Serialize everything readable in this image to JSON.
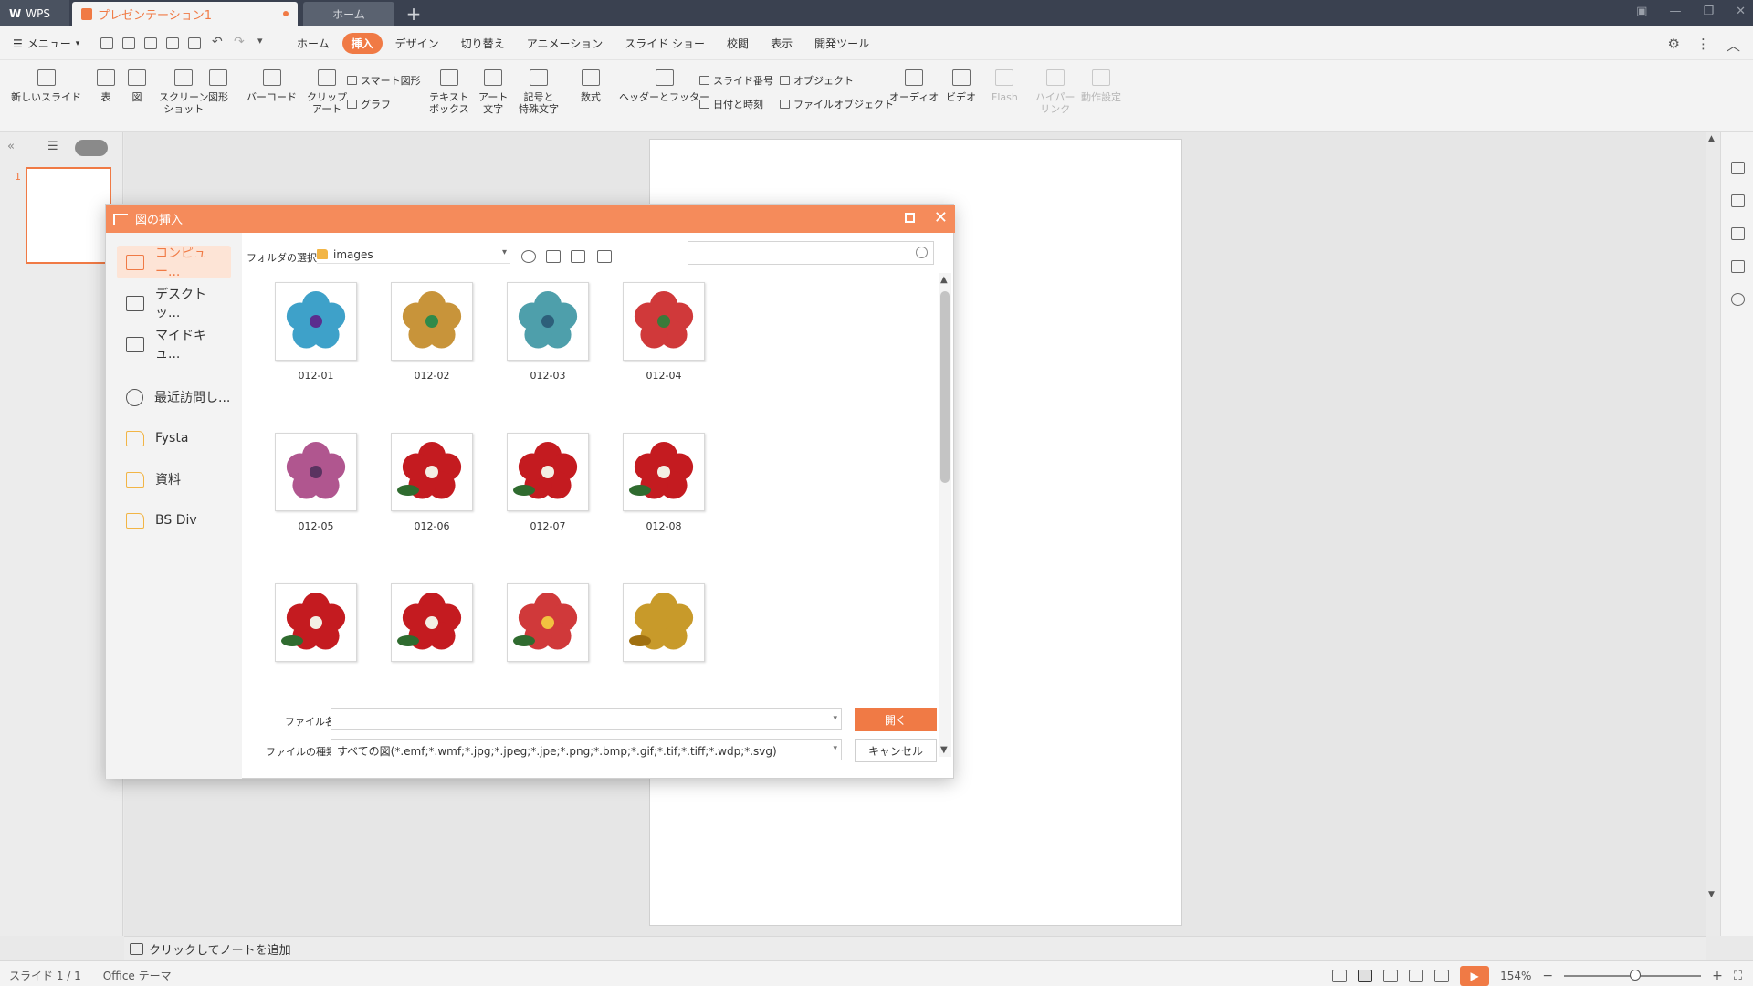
{
  "titlebar": {
    "app_tab": "WPS",
    "doc_tab": "プレゼンテーション1",
    "home_tab": "ホーム",
    "new_tab": "+"
  },
  "menubar": {
    "menu_label": "メニュー",
    "tabs": [
      "ホーム",
      "挿入",
      "デザイン",
      "切り替え",
      "アニメーション",
      "スライド ショー",
      "校閲",
      "表示",
      "開発ツール"
    ],
    "active_tab": "挿入"
  },
  "ribbon": {
    "new_slide": "新しいスライド",
    "table": "表",
    "picture": "図",
    "screenshot_1": "スクリーン",
    "screenshot_2": "ショット",
    "shape": "図形",
    "barcode": "バーコード",
    "clipart_1": "クリップ",
    "clipart_2": "アート",
    "smart_shape": "スマート図形",
    "chart": "グラフ",
    "textbox_1": "テキスト",
    "textbox_2": "ボックス",
    "wordart_1": "アート",
    "wordart_2": "文字",
    "symbols_1": "記号と",
    "symbols_2": "特殊文字",
    "equation": "数式",
    "header_footer": "ヘッダーとフッター",
    "slide_number": "スライド番号",
    "date_time": "日付と時刻",
    "object": "オブジェクト",
    "file_object": "ファイルオブジェクト",
    "audio": "オーディオ",
    "video": "ビデオ",
    "flash": "Flash",
    "hyperlink_1": "ハイパー",
    "hyperlink_2": "リンク",
    "action": "動作設定"
  },
  "slides_panel": {
    "slide_number": "1"
  },
  "notes": {
    "placeholder": "クリックしてノートを追加"
  },
  "statusbar": {
    "slide_info": "スライド 1 / 1",
    "theme": "Office テーマ",
    "zoom": "154%",
    "zoom_level": 0.52
  },
  "dialog": {
    "title": "図の挿入",
    "sidebar": [
      {
        "label": "コンピュー...",
        "icon": "computer-icon"
      },
      {
        "label": "デスクトッ...",
        "icon": "desktop-icon"
      },
      {
        "label": "マイドキュ...",
        "icon": "documents-icon"
      },
      {
        "label": "最近訪問し...",
        "icon": "clock-icon"
      },
      {
        "label": "Fysta",
        "icon": "folder-icon"
      },
      {
        "label": "資料",
        "icon": "folder-icon"
      },
      {
        "label": "BS Div",
        "icon": "folder-icon"
      }
    ],
    "folder_label": "フォルダの選択",
    "folder_value": "images",
    "search_placeholder": "",
    "files": [
      {
        "name": "012-01",
        "colors": [
          "#3ea1c9",
          "#2a7fa8"
        ],
        "center": "#5b2d8e"
      },
      {
        "name": "012-02",
        "colors": [
          "#c8943a",
          "#a87520"
        ],
        "center": "#2f8a4a"
      },
      {
        "name": "012-03",
        "colors": [
          "#4e9fab",
          "#3a8590"
        ],
        "center": "#2d5f7a"
      },
      {
        "name": "012-04",
        "colors": [
          "#d0393a",
          "#b02425"
        ],
        "center": "#3a7a3a"
      },
      {
        "name": "012-05",
        "colors": [
          "#b0568f",
          "#913f76"
        ],
        "center": "#5a3360"
      },
      {
        "name": "012-06",
        "colors": [
          "#c41b20",
          "#2f6b2f"
        ],
        "center": "#f3efe4"
      },
      {
        "name": "012-07",
        "colors": [
          "#c41b20",
          "#2f6b2f"
        ],
        "center": "#f3efe4"
      },
      {
        "name": "012-08",
        "colors": [
          "#c41b20",
          "#2f6b2f"
        ],
        "center": "#f3efe4"
      },
      {
        "name": "",
        "colors": [
          "#c41b20",
          "#2f6b2f"
        ],
        "center": "#f3efe4"
      },
      {
        "name": "",
        "colors": [
          "#c41b20",
          "#2f6b2f"
        ],
        "center": "#f3efe4"
      },
      {
        "name": "",
        "colors": [
          "#d0393a",
          "#2f6b2f"
        ],
        "center": "#f2c240"
      },
      {
        "name": "",
        "colors": [
          "#c89a2a",
          "#a07010"
        ],
        "center": "#c89a2a"
      }
    ],
    "filename_label": "ファイル名",
    "filename_value": "",
    "filetype_label": "ファイルの種類",
    "filetype_value": "すべての図(*.emf;*.wmf;*.jpg;*.jpeg;*.jpe;*.png;*.bmp;*.gif;*.tif;*.tiff;*.wdp;*.svg)",
    "open_button": "開く",
    "cancel_button": "キャンセル"
  },
  "colors": {
    "accent": "#f07a45",
    "titlebar": "#3a4150",
    "dialog_title": "#f58b5b"
  }
}
